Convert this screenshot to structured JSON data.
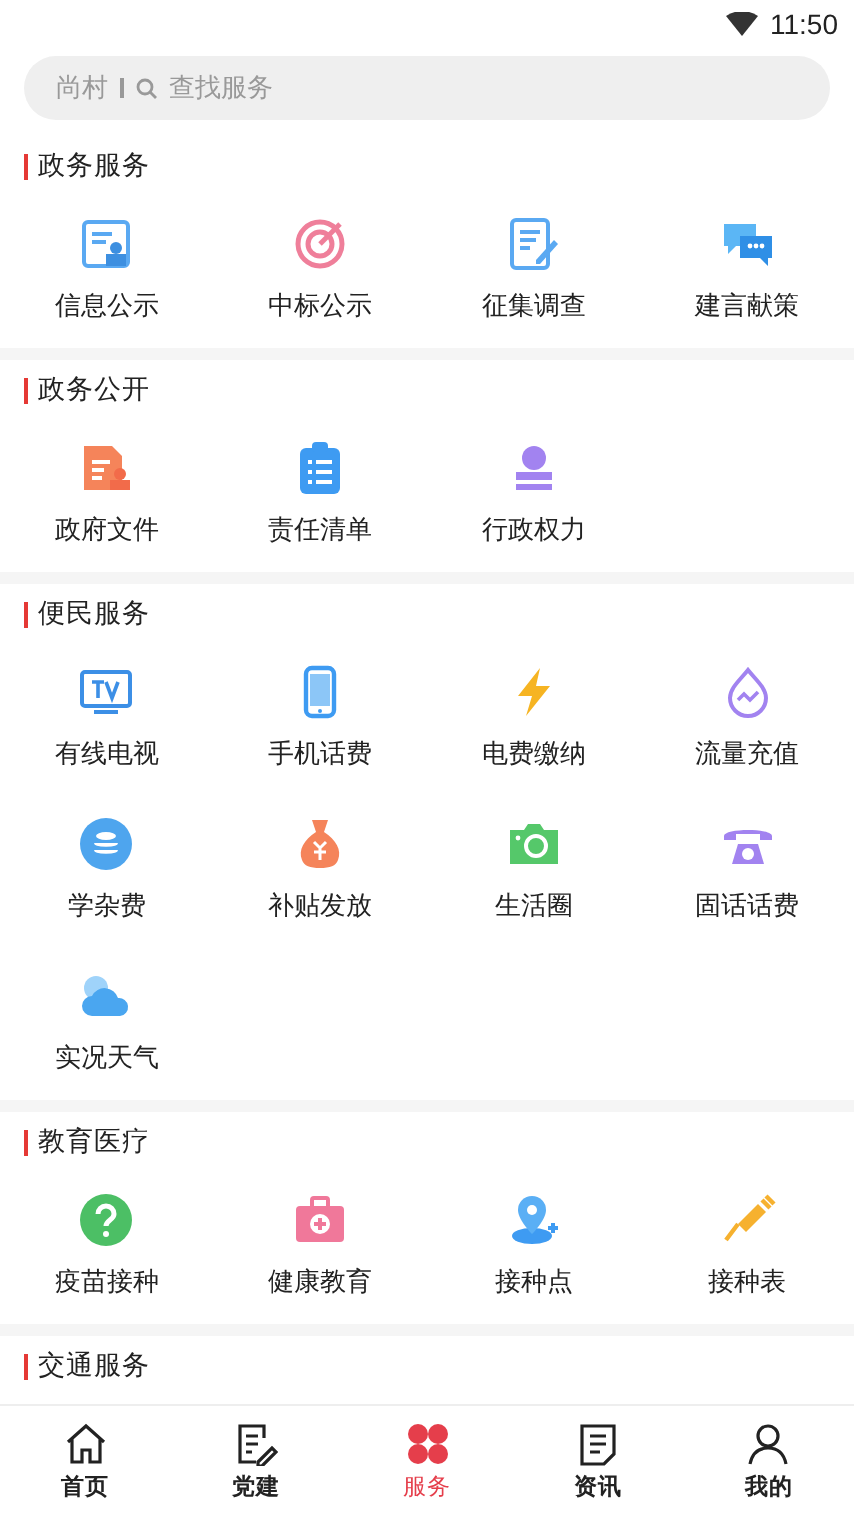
{
  "status_bar": {
    "time": "11:50"
  },
  "search": {
    "location": "尚村",
    "placeholder": "查找服务"
  },
  "sections": [
    {
      "title": "政务服务",
      "items": [
        {
          "label": "信息公示"
        },
        {
          "label": "中标公示"
        },
        {
          "label": "征集调查"
        },
        {
          "label": "建言献策"
        }
      ]
    },
    {
      "title": "政务公开",
      "items": [
        {
          "label": "政府文件"
        },
        {
          "label": "责任清单"
        },
        {
          "label": "行政权力"
        }
      ]
    },
    {
      "title": "便民服务",
      "items": [
        {
          "label": "有线电视"
        },
        {
          "label": "手机话费"
        },
        {
          "label": "电费缴纳"
        },
        {
          "label": "流量充值"
        },
        {
          "label": "学杂费"
        },
        {
          "label": "补贴发放"
        },
        {
          "label": "生活圈"
        },
        {
          "label": "固话话费"
        },
        {
          "label": "实况天气"
        }
      ]
    },
    {
      "title": "教育医疗",
      "items": [
        {
          "label": "疫苗接种"
        },
        {
          "label": "健康教育"
        },
        {
          "label": "接种点"
        },
        {
          "label": "接种表"
        }
      ]
    },
    {
      "title": "交通服务"
    }
  ],
  "bottom_nav": [
    {
      "label": "首页",
      "selected": false
    },
    {
      "label": "党建",
      "selected": false
    },
    {
      "label": "服务",
      "selected": true
    },
    {
      "label": "资讯",
      "selected": false
    },
    {
      "label": "我的",
      "selected": false
    }
  ]
}
